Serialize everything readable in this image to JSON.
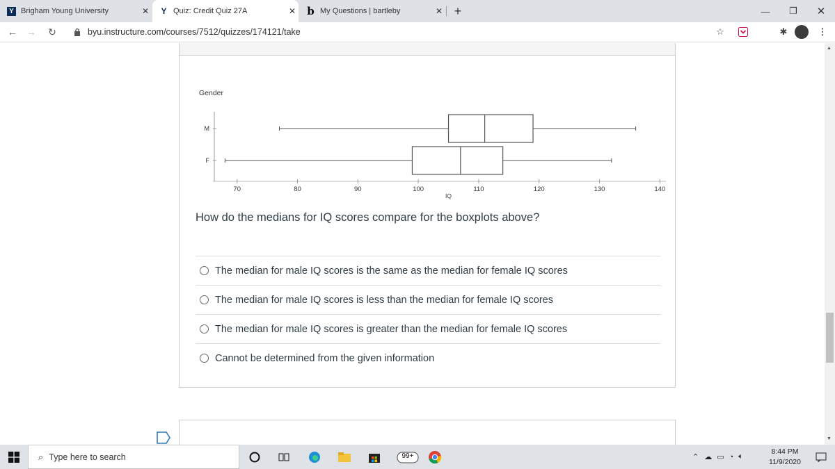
{
  "browser": {
    "tabs": [
      {
        "favicon": "Y",
        "title": "Brigham Young University",
        "active": false
      },
      {
        "favicon": "Y",
        "title": "Quiz: Credit Quiz 27A",
        "active": true
      },
      {
        "favicon": "b",
        "title": "My Questions | bartleby",
        "active": false
      }
    ],
    "new_tab": "+",
    "url": "byu.instructure.com/courses/7512/quizzes/174121/take"
  },
  "question": {
    "text": "How do the medians for IQ scores compare for the boxplots above?",
    "options": [
      "The median for male IQ scores is the same as the median for female IQ scores",
      "The median for male IQ scores is less than the median for female IQ scores",
      "The median for male IQ scores is greater than the median for female IQ scores",
      "Cannot be determined from the given information"
    ]
  },
  "chart_data": {
    "type": "boxplot",
    "ylabel": "Gender",
    "xlabel": "IQ",
    "xlim": [
      66,
      141
    ],
    "xticks": [
      70,
      80,
      90,
      100,
      110,
      120,
      130,
      140
    ],
    "categories": [
      "M",
      "F"
    ],
    "series": [
      {
        "name": "M",
        "min": 77,
        "q1": 105,
        "median": 111,
        "q3": 119,
        "max": 136
      },
      {
        "name": "F",
        "min": 68,
        "q1": 99,
        "median": 107,
        "q3": 114,
        "max": 132
      }
    ]
  },
  "taskbar": {
    "search_placeholder": "Type here to search",
    "badge": "99+",
    "time": "8:44 PM",
    "date": "11/9/2020"
  },
  "colors": {
    "tabstrip": "#dee1e6",
    "taskbar": "#dfe3e8",
    "text": "#2d3b45"
  }
}
